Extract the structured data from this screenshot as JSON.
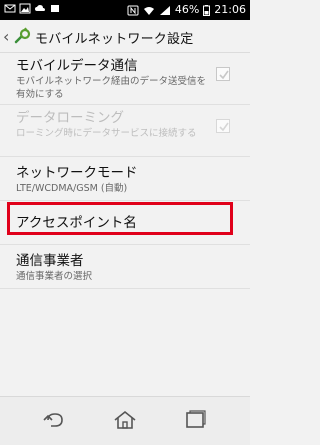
{
  "status_bar": {
    "left_icons": [
      "email-icon",
      "image-icon",
      "cloud-icon",
      "notification-icon"
    ],
    "right_icons": [
      "nfc-icon",
      "wifi-icon",
      "signal-icon",
      "battery-icon"
    ],
    "battery": "46%",
    "time": "21:06"
  },
  "action_bar": {
    "title": "モバイルネットワーク設定"
  },
  "settings": [
    {
      "title": "モバイルデータ通信",
      "subtitle": "モバイルネットワーク経由のデータ送受信を有効にする",
      "checked": true,
      "enabled": true
    },
    {
      "title": "データローミング",
      "subtitle": "ローミング時にデータサービスに接続する",
      "checked": true,
      "enabled": false
    },
    {
      "title": "ネットワークモード",
      "subtitle": "LTE/WCDMA/GSM (自動)"
    },
    {
      "title": "アクセスポイント名"
    },
    {
      "title": "通信事業者",
      "subtitle": "通信事業者の選択"
    }
  ],
  "colors": {
    "highlight": "#e0001a",
    "background": "#f2f2f2"
  },
  "nav_bar": [
    "back-icon",
    "home-icon",
    "recent-apps-icon"
  ]
}
